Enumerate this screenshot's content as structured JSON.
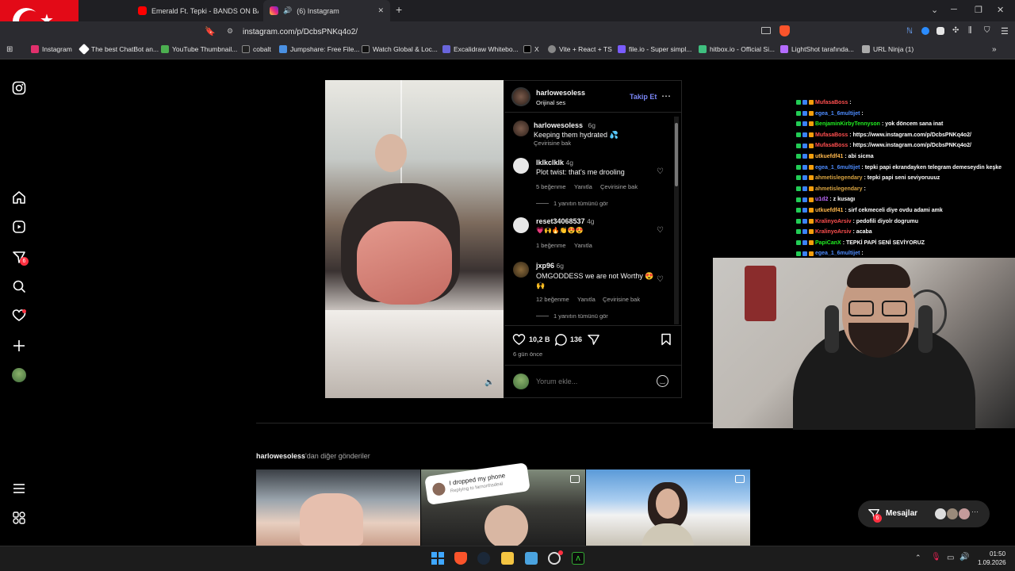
{
  "browser": {
    "tabs": [
      {
        "title": "Emerald Ft. Tepki - BANDS ON BAND..."
      },
      {
        "title": "(6) Instagram"
      }
    ],
    "url": "instagram.com/p/DcbsPNKq4o2/",
    "bookmarks": [
      {
        "label": "Instagram"
      },
      {
        "label": "The best ChatBot an..."
      },
      {
        "label": "YouTube Thumbnail..."
      },
      {
        "label": "cobalt"
      },
      {
        "label": "Jumpshare: Free File..."
      },
      {
        "label": "Watch Global & Loc..."
      },
      {
        "label": "Excalidraw Whitebo..."
      },
      {
        "label": "X"
      },
      {
        "label": "Vite + React + TS"
      },
      {
        "label": "file.io - Super simpl..."
      },
      {
        "label": "hitbox.io - Official Si..."
      },
      {
        "label": "LightShot tarafında..."
      },
      {
        "label": "URL Ninja (1)"
      }
    ]
  },
  "sidebar": {
    "notification_count": "6"
  },
  "post": {
    "username": "harlowesoless",
    "audio": "Orijinal ses",
    "follow_label": "Takip Et",
    "caption": {
      "user": "harlowesoless",
      "time": "6g",
      "text": "Keeping them hydrated 💦",
      "translate": "Çevirisine bak"
    },
    "comments": [
      {
        "user": "lklkclklk",
        "time": "4g",
        "text": "Plot twist: that's me drooling",
        "likes": "5 beğenme",
        "reply": "Yanıtla",
        "translate": "Çevirisine bak",
        "more": "1 yanıtın tümünü gör"
      },
      {
        "user": "reset34068537",
        "time": "4g",
        "text": "💗🙌🔥👏😍😍",
        "likes": "1 beğenme",
        "reply": "Yanıtla"
      },
      {
        "user": "jxp96",
        "time": "6g",
        "text": "OMGODDESS we are not Worthy 😍🙌",
        "likes": "12 beğenme",
        "reply": "Yanıtla",
        "translate": "Çevirisine bak",
        "more": "1 yanıtın tümünü gör"
      }
    ],
    "like_count": "10,2 B",
    "comment_count": "136",
    "age": "6 gün önce",
    "comment_placeholder": "Yorum ekle..."
  },
  "more_posts": {
    "user": "harlowesoless",
    "suffix": "'dan diğer gönderiler",
    "sticker_text": "I dropped my phone",
    "sticker_sub": "Replying to farnorthsdeal"
  },
  "chat": [
    {
      "user": "MufasaBoss",
      "text": ":",
      "color": "#ff4f4f"
    },
    {
      "user": "egea_1_6multijet",
      "text": ":",
      "color": "#4d8cff"
    },
    {
      "user": "BenjaminKirbyTennyson",
      "text": ": yok döncem sana inat",
      "color": "#22ee22"
    },
    {
      "user": "MufasaBoss",
      "text": ": https://www.instagram.com/p/DcbsPNKq4o2/",
      "color": "#ff4f4f"
    },
    {
      "user": "MufasaBoss",
      "text": ": https://www.instagram.com/p/DcbsPNKq4o2/",
      "color": "#ff4f4f"
    },
    {
      "user": "utkuefdf41",
      "text": ": abi sicma",
      "color": "#ffb84d"
    },
    {
      "user": "egea_1_6multijet",
      "text": ": tepki papi ekrandayken telegram demeseydin keşke",
      "color": "#4d8cff"
    },
    {
      "user": "ahmetislegendary",
      "text": ": tepki papi seni seviyoruuuz",
      "color": "#d9a441"
    },
    {
      "user": "ahmetislegendary",
      "text": ":",
      "color": "#d9a441"
    },
    {
      "user": "u1d2",
      "text": ": z kusagı",
      "color": "#c06cff"
    },
    {
      "user": "utkuefdf41",
      "text": ": sirf cekmeceli diye ovdu adami amk",
      "color": "#ffb84d"
    },
    {
      "user": "KralinyoArsiv",
      "text": ": pedofili diyolr dogrumu",
      "color": "#ff4f4f"
    },
    {
      "user": "KralinyoArsiv",
      "text": ": acaba",
      "color": "#ff4f4f"
    },
    {
      "user": "PapiCanX",
      "text": ": TEPKİ PAPİ SENİ SEVİYORUZ",
      "color": "#22ee22"
    },
    {
      "user": "egea_1_6multijet",
      "text": ":",
      "color": "#4d8cff"
    }
  ],
  "messages": {
    "label": "Mesajlar",
    "count": "6"
  },
  "taskbar": {
    "time": "01:50",
    "date": "1.09.2026"
  },
  "colors": {
    "accent": "#0095f6",
    "follow": "#7a86f5",
    "badge": "#ff3040"
  }
}
